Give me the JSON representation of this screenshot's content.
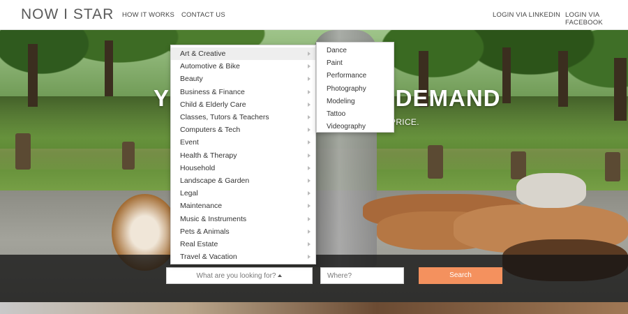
{
  "brand": {
    "logo": "NOW I STAR"
  },
  "nav": {
    "how_it_works": "HOW IT WORKS",
    "contact_us": "CONTACT US",
    "login_linkedin": "LOGIN VIA LINKEDIN",
    "login_facebook": "LOGIN VIA FACEBOOK"
  },
  "hero": {
    "headline_left": "Y",
    "headline_right": "ON DEMAND",
    "subline": "HEDULE, YOUR PRICE."
  },
  "search": {
    "what_placeholder": "What are you looking for?",
    "where_placeholder": "Where?",
    "button_label": "Search"
  },
  "categories": [
    "Art & Creative",
    "Automotive & Bike",
    "Beauty",
    "Business & Finance",
    "Child & Elderly Care",
    "Classes, Tutors & Teachers",
    "Computers & Tech",
    "Event",
    "Health & Therapy",
    "Household",
    "Landscape & Garden",
    "Legal",
    "Maintenance",
    "Music & Instruments",
    "Pets & Animals",
    "Real Estate",
    "Travel & Vacation"
  ],
  "active_category": "Art & Creative",
  "subcategories": [
    "Dance",
    "Paint",
    "Performance",
    "Photography",
    "Modeling",
    "Tattoo",
    "Videography"
  ],
  "colors": {
    "search_button": "#f4915e",
    "search_band": "#141414",
    "menu_highlight": "#eeeeee"
  }
}
